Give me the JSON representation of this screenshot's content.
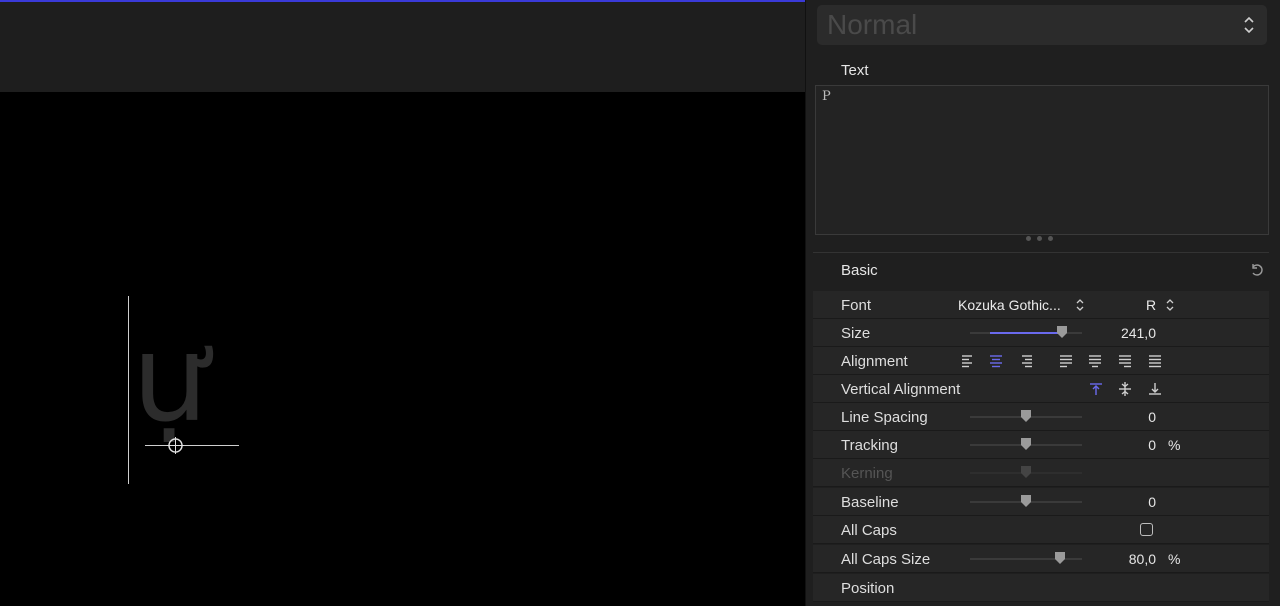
{
  "viewer": {
    "glyph": "ự"
  },
  "inspector": {
    "style_select": {
      "value": "Normal"
    },
    "text_section": {
      "title": "Text",
      "content": "P"
    },
    "basic": {
      "title": "Basic",
      "font": {
        "label": "Font",
        "family": "Kozuka Gothic...",
        "style": "R"
      },
      "size": {
        "label": "Size",
        "value": "241,0",
        "slider_fraction": 0.82
      },
      "alignment": {
        "label": "Alignment",
        "selected": "center"
      },
      "vertical_alignment": {
        "label": "Vertical Alignment",
        "selected": "top"
      },
      "line_spacing": {
        "label": "Line Spacing",
        "value": "0",
        "slider_fraction": 0.5
      },
      "tracking": {
        "label": "Tracking",
        "value": "0",
        "unit": "%",
        "slider_fraction": 0.5
      },
      "kerning": {
        "label": "Kerning",
        "disabled": true,
        "slider_fraction": 0.5
      },
      "baseline": {
        "label": "Baseline",
        "value": "0",
        "slider_fraction": 0.5
      },
      "all_caps": {
        "label": "All Caps",
        "checked": false
      },
      "all_caps_size": {
        "label": "All Caps Size",
        "value": "80,0",
        "unit": "%",
        "slider_fraction": 0.8
      },
      "position": {
        "label": "Position"
      }
    }
  },
  "colors": {
    "accent": "#6a6aee",
    "panel_bg": "#1f1f1f",
    "row_bg": "#262626"
  }
}
